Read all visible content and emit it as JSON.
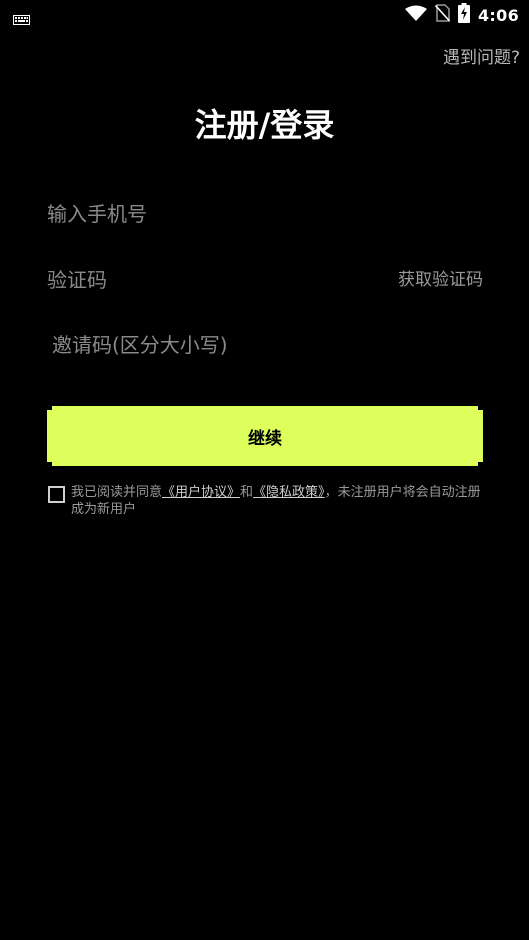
{
  "status_bar": {
    "time": "4:06",
    "icons": [
      "keyboard-icon",
      "wifi-icon",
      "no-sim-icon",
      "battery-charging-icon"
    ]
  },
  "header": {
    "help_link": "遇到问题?",
    "title": "注册/登录"
  },
  "form": {
    "phone_placeholder": "输入手机号",
    "phone_value": "",
    "code_placeholder": "验证码",
    "code_value": "",
    "get_code_label": "获取验证码",
    "invite_placeholder": "邀请码(区分大小写)",
    "invite_value": "",
    "continue_label": "继续"
  },
  "agreement": {
    "checked": false,
    "prefix": "我已阅读并同意",
    "user_agreement": "《用户协议》",
    "and": "和",
    "privacy_policy": "《隐私政策》",
    "suffix": "，未注册用户将会自动注册成为新用户"
  },
  "colors": {
    "background": "#000000",
    "accent": "#dcff5b",
    "text_primary": "#ffffff",
    "text_secondary": "#9a9a9a"
  }
}
